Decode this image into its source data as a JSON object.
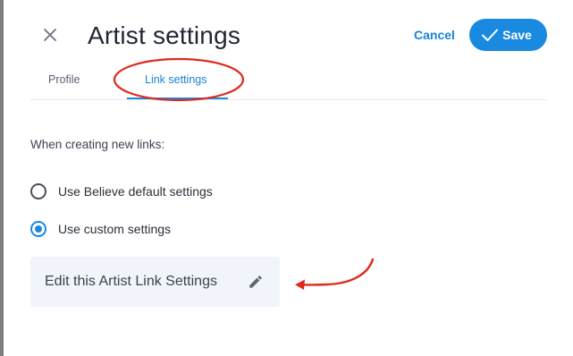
{
  "header": {
    "title": "Artist settings",
    "cancel_label": "Cancel",
    "save_label": "Save",
    "close_icon": "close-icon",
    "save_icon": "checkmark-icon"
  },
  "tabs": [
    {
      "label": "Profile",
      "selected": false
    },
    {
      "label": "Link settings",
      "selected": true
    }
  ],
  "content": {
    "section_label": "When creating new links:",
    "options": [
      {
        "label": "Use Believe default settings",
        "checked": false
      },
      {
        "label": "Use custom settings",
        "checked": true
      }
    ],
    "edit_card": {
      "label": "Edit this Artist Link Settings",
      "icon": "pencil-icon"
    }
  },
  "colors": {
    "accent": "#1a8ae0",
    "annotation": "#e0281c",
    "title_text": "#1f2733",
    "card_bg": "#f1f4fa"
  }
}
